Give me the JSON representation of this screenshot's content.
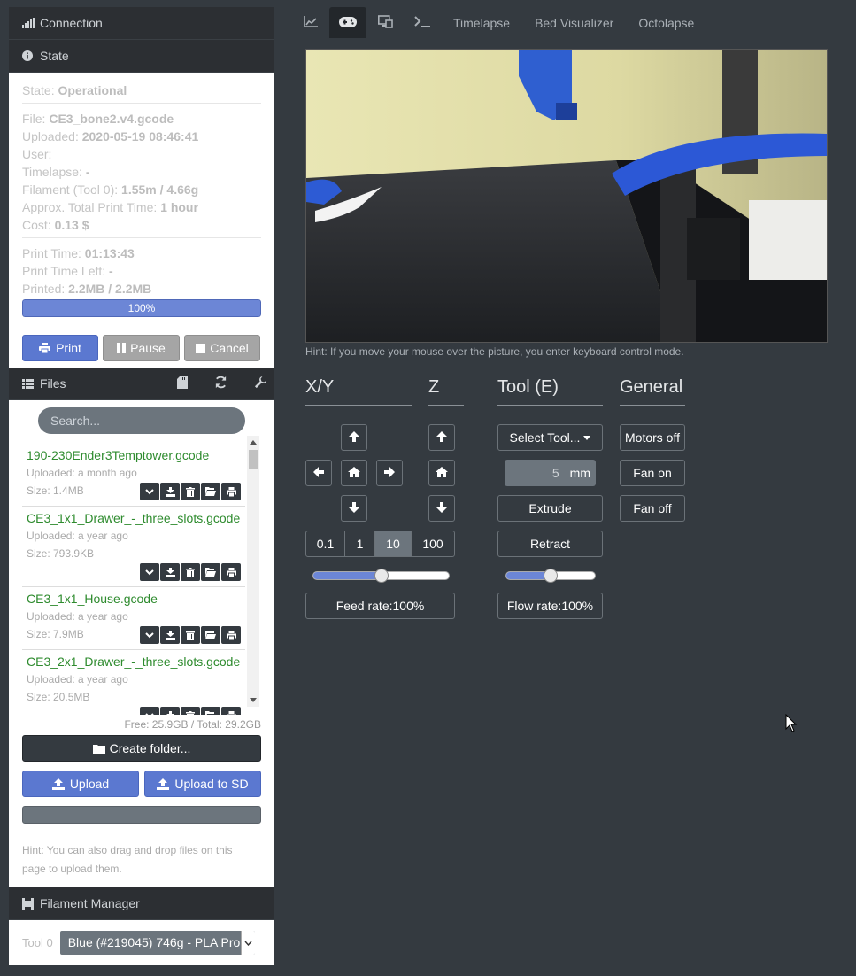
{
  "sidebar": {
    "connection_title": "Connection",
    "state_title": "State",
    "state": {
      "state_label": "State: ",
      "state_value": "Operational",
      "file_label": "File: ",
      "file_value": "CE3_bone2.v4.gcode",
      "uploaded_label": "Uploaded: ",
      "uploaded_value": "2020-05-19 08:46:41",
      "user_label": "User:",
      "timelapse_label": "Timelapse: ",
      "timelapse_value": "-",
      "filament_label": "Filament (Tool 0): ",
      "filament_value": "1.55m / 4.66g",
      "approx_label": "Approx. Total Print Time: ",
      "approx_value": "1 hour",
      "cost_label": "Cost: ",
      "cost_value": "0.13 $",
      "print_time_label": "Print Time: ",
      "print_time_value": "01:13:43",
      "time_left_label": "Print Time Left: ",
      "time_left_value": "-",
      "printed_label": "Printed: ",
      "printed_value": "2.2MB / 2.2MB",
      "progress_text": "100%",
      "progress_fraction": 1.0
    },
    "buttons": {
      "print": "Print",
      "pause": "Pause",
      "cancel": "Cancel"
    },
    "files_title": "Files",
    "search_placeholder": "Search...",
    "files": [
      {
        "name": "190-230Ender3Temptower.gcode",
        "uploaded": "Uploaded: a month ago",
        "size": "Size: 1.4MB"
      },
      {
        "name": "CE3_1x1_Drawer_-_three_slots.gcode",
        "uploaded": "Uploaded: a year ago",
        "size": "Size: 793.9KB"
      },
      {
        "name": "CE3_1x1_House.gcode",
        "uploaded": "Uploaded: a year ago",
        "size": "Size: 7.9MB"
      },
      {
        "name": "CE3_2x1_Drawer_-_three_slots.gcode",
        "uploaded": "Uploaded: a year ago",
        "size": "Size: 20.5MB"
      }
    ],
    "storage": "Free: 25.9GB / Total: 29.2GB",
    "create_folder": "Create folder...",
    "upload": "Upload",
    "upload_sd": "Upload to SD",
    "files_hint": "Hint: You can also drag and drop files on this page to upload them.",
    "filament_manager_title": "Filament Manager",
    "tool_label": "Tool 0",
    "tool_spool": "Blue (#219045) 746g - PLA Pro"
  },
  "tabs": [
    "Timelapse",
    "Bed Visualizer",
    "Octolapse"
  ],
  "icon_tabs": [
    "graph-icon",
    "gamepad-icon",
    "gcode-viewer-icon",
    "terminal-icon"
  ],
  "webcam_hint": "Hint: If you move your mouse over the picture, you enter keyboard control mode.",
  "control": {
    "xy_title": "X/Y",
    "z_title": "Z",
    "tool_title": "Tool (E)",
    "general_title": "General",
    "steps": [
      "0.1",
      "1",
      "10",
      "100"
    ],
    "active_step": "10",
    "select_tool": "Select Tool...",
    "extrude_amount": "5",
    "extrude_unit": "mm",
    "extrude": "Extrude",
    "retract": "Retract",
    "feed_rate": "Feed rate:100%",
    "flow_rate": "Flow rate:100%",
    "feed_fraction": 0.5,
    "flow_fraction": 0.5,
    "motors_off": "Motors off",
    "fan_on": "Fan on",
    "fan_off": "Fan off"
  },
  "colors": {
    "accent": "#5b78d0",
    "file_green": "#2e8b2e",
    "background": "#343a40"
  }
}
